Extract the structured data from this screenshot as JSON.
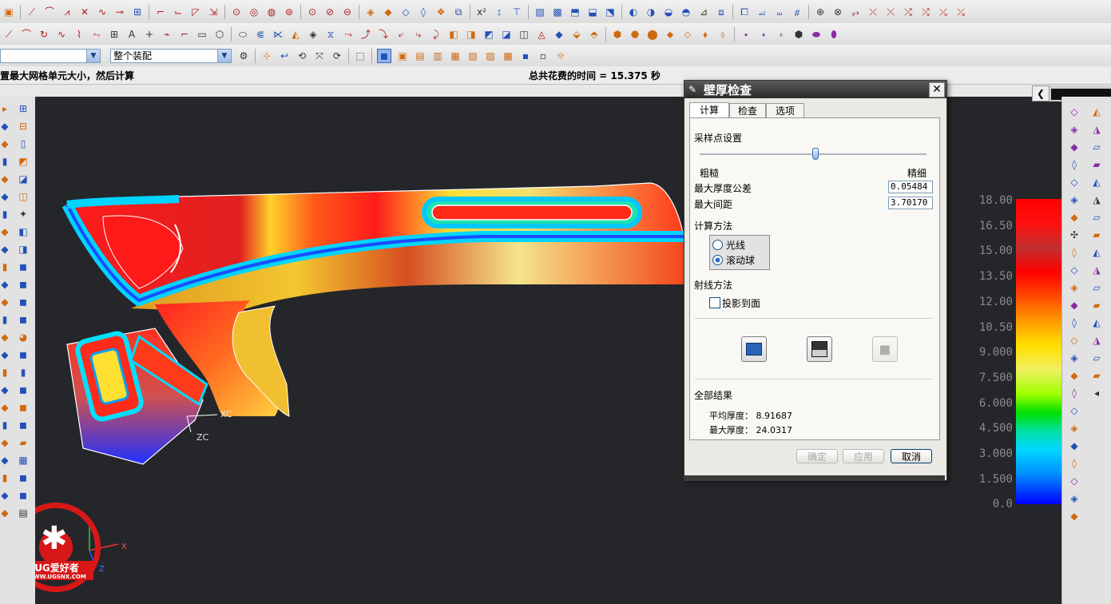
{
  "toolbar_row1": [
    "line",
    "arc",
    "sketch",
    "trim",
    "spline",
    "offset",
    "fillet",
    "chamfer",
    "circle",
    "point",
    "plane",
    "csys",
    "extrude",
    "revolve",
    "hole",
    "boss",
    "pocket",
    "pad",
    "blend",
    "shell",
    "mirror",
    "pattern",
    "measure",
    "view",
    "zoom",
    "pan",
    "rotate",
    "section"
  ],
  "toolbar_row2": [
    "profile",
    "arc",
    "spline",
    "curve",
    "offset",
    "project",
    "rectangle",
    "text",
    "plus",
    "helix",
    "line",
    "rectangle-sel",
    "circle",
    "ellipse",
    "intersect",
    "bridge",
    "join",
    "extract",
    "trim-body",
    "split",
    "surface",
    "sew",
    "thicken",
    "block",
    "cylinder",
    "cone",
    "sphere",
    "unite",
    "subtract",
    "intersect",
    "assembly",
    "component"
  ],
  "assembly_combo": {
    "value": ""
  },
  "selection_combo": {
    "value": "整个装配"
  },
  "status": {
    "prompt": "置最大网格单元大小，然后计算",
    "time": "总共花费的时间 = 15.375 秒"
  },
  "dialog": {
    "title": "壁厚检查",
    "close_label": "✕",
    "tabs": [
      "计算",
      "检查",
      "选项"
    ],
    "sampling_label": "采样点设置",
    "slider_level": 0.51,
    "coarse_label": "粗糙",
    "fine_label": "精细",
    "max_thickness_tol_label": "最大厚度公差",
    "max_thickness_tol_value": "0.05484",
    "max_spacing_label": "最大间距",
    "max_spacing_value": "3.70170",
    "calc_method_label": "计算方法",
    "radio_ray": "光线",
    "radio_ball": "滚动球",
    "ray_method_label": "射线方法",
    "project_to_face": "投影到面",
    "results_label": "全部结果",
    "avg_thickness": "平均厚度： 8.91687",
    "max_thickness": "最大厚度： 24.0317",
    "ok": "确定",
    "apply": "应用",
    "cancel": "取消"
  },
  "scale": [
    "18.00",
    "16.50",
    "15.00",
    "13.50",
    "12.00",
    "10.50",
    "9.000",
    "7.500",
    "6.000",
    "4.500",
    "3.000",
    "1.500",
    "0.0"
  ],
  "viewport_labels": {
    "xc": "XC",
    "zc": "ZC",
    "x": "X",
    "z": "Z"
  },
  "watermark": {
    "brand": "UG爱好者",
    "url": "WWW.UGSNX.COM"
  },
  "colors": {
    "viewport": "#24262a",
    "dialog_title": "#3a3a3a",
    "hot": "#ff1a1a",
    "cool": "#0026ff"
  }
}
